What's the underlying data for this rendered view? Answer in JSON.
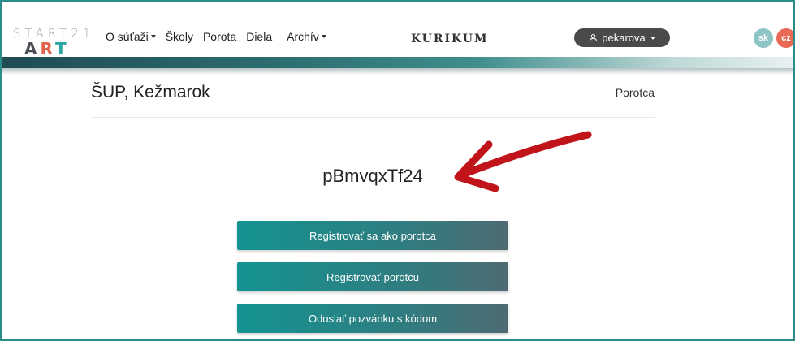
{
  "logo": {
    "top_text": "START21",
    "letters": {
      "a": "A",
      "r": "R",
      "t": "T"
    }
  },
  "nav": {
    "items": [
      {
        "label": "O súťaži",
        "dropdown": true
      },
      {
        "label": "Školy",
        "dropdown": false
      },
      {
        "label": "Porota",
        "dropdown": false
      },
      {
        "label": "Diela",
        "dropdown": false
      },
      {
        "label": "Archív",
        "dropdown": true
      }
    ]
  },
  "brand": {
    "label": "KURIKUM"
  },
  "user": {
    "name": "pekarova",
    "icon": "user-icon"
  },
  "languages": [
    {
      "code": "sk",
      "color": "#8fc4c5"
    },
    {
      "code": "cz",
      "color": "#e86a55"
    }
  ],
  "page": {
    "title": "ŠUP, Kežmarok",
    "role": "Porotca",
    "code": "pBmvqxTf24"
  },
  "actions": {
    "register_self": "Registrovať sa ako porotca",
    "register_other": "Registrovať porotcu",
    "send_invite": "Odoslať pozvánku s kódom"
  },
  "annotation": {
    "icon": "arrow-icon",
    "color": "#c0141a"
  },
  "colors": {
    "accent": "#149392",
    "frame": "#2b8c8a",
    "pill": "#4a4a4c"
  }
}
